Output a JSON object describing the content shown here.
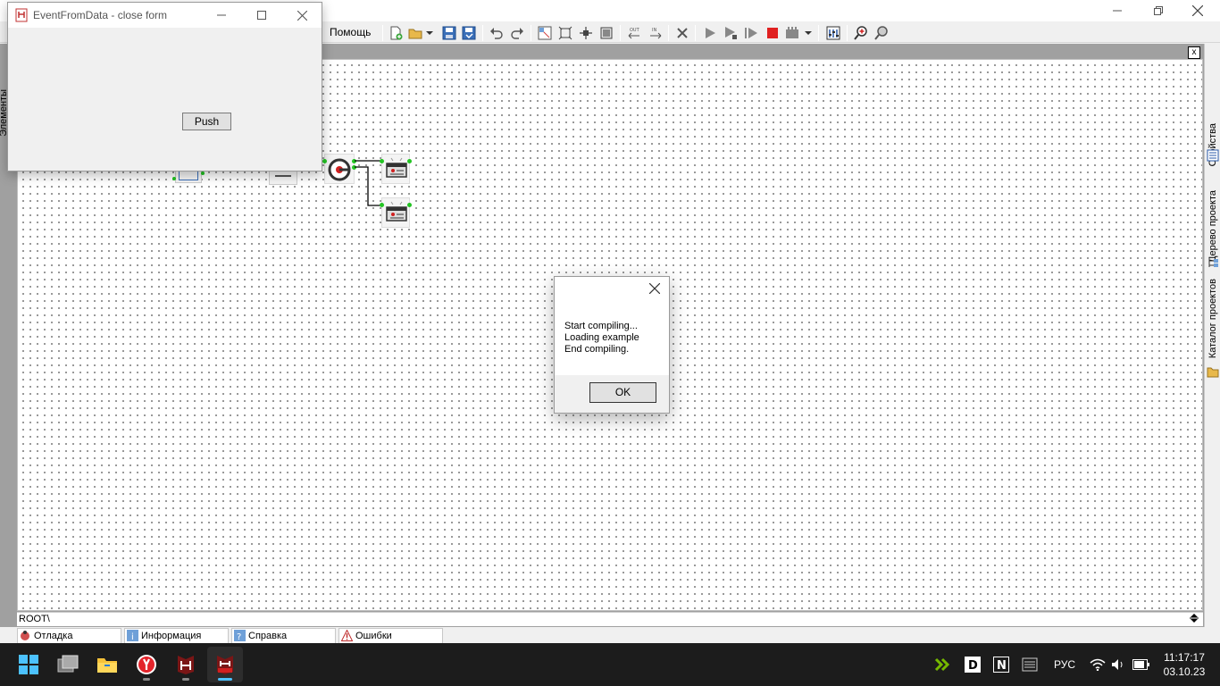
{
  "main_window": {
    "menu_help": "Помощь"
  },
  "form": {
    "title": "EventFromData - close form",
    "push_label": "Push"
  },
  "dialog": {
    "lines": [
      "Start compiling...",
      "Loading example",
      "End compiling."
    ],
    "ok_label": "OK"
  },
  "canvas": {
    "path": "ROOT\\",
    "close_label": "x"
  },
  "side_panel": {
    "tabs": [
      "Свойства",
      "Дерево проекта",
      "Каталог проектов"
    ],
    "left_partial": "Элементы"
  },
  "bottom_tabs": [
    {
      "label": "Отладка",
      "icon": "bug-icon"
    },
    {
      "label": "Информация",
      "icon": "info-icon"
    },
    {
      "label": "Справка",
      "icon": "help-icon"
    },
    {
      "label": "Ошибки",
      "icon": "warning-icon"
    }
  ],
  "taskbar": {
    "language": "РУС",
    "time": "11:17:17",
    "date": "03.10.23",
    "apps": [
      "start-icon",
      "task-view-icon",
      "file-explorer-icon",
      "yandex-browser-icon",
      "hiasm-icon",
      "hiasm-test-icon"
    ]
  },
  "colors": {
    "accent": "#4cc2ff",
    "stop_red": "#e02020",
    "connector_green": "#22c422"
  }
}
